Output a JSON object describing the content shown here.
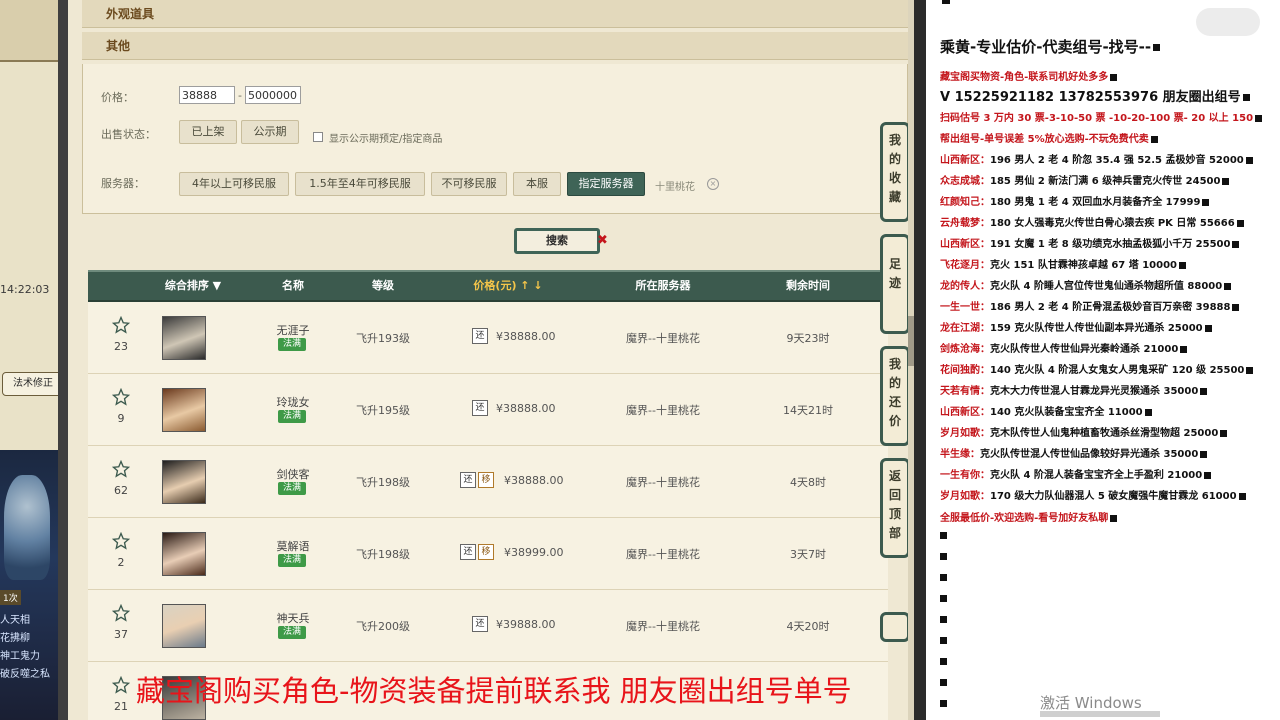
{
  "left_strip": {
    "time": "14:22:03",
    "magic_button": "法术修正",
    "count_badge": "1次",
    "lines": [
      "人天相",
      "花拂柳",
      "神工鬼力",
      "破反噬之私"
    ]
  },
  "sections": {
    "appearance": "外观道具",
    "other": "其他"
  },
  "filter": {
    "price_label": "价格：",
    "price_min": "38888",
    "price_max": "5000000",
    "price_sep": "-",
    "sale_status_label": "出售状态：",
    "status_options": [
      "已上架",
      "公示期"
    ],
    "publicity_checkbox_label": "显示公示期预定/指定商品",
    "server_label": "服务器：",
    "server_options": [
      "4年以上可移民服",
      "1.5年至4年可移民服",
      "不可移民服",
      "本服",
      "指定服务器"
    ],
    "selected_server": "十里桃花",
    "close_glyph": "×"
  },
  "search": {
    "label": "搜索",
    "x_glyph": "✖"
  },
  "table": {
    "headers": {
      "sort": "综合排序 ▼",
      "name": "名称",
      "level": "等级",
      "price": "价格(元) ↑ ↓",
      "server": "所在服务器",
      "remain": "剩余时间"
    },
    "rows": [
      {
        "fav": "23",
        "name": "无涯子",
        "school": "法满",
        "level": "飞升193级",
        "tags": [
          "还"
        ],
        "price": "¥38888.00",
        "server": "魔界--十里桃花",
        "remain": "9天23时"
      },
      {
        "fav": "9",
        "name": "玲珑女",
        "school": "法满",
        "level": "飞升195级",
        "tags": [
          "还"
        ],
        "price": "¥38888.00",
        "server": "魔界--十里桃花",
        "remain": "14天21时"
      },
      {
        "fav": "62",
        "name": "剑侠客",
        "school": "法满",
        "level": "飞升198级",
        "tags": [
          "还",
          "移"
        ],
        "price": "¥38888.00",
        "server": "魔界--十里桃花",
        "remain": "4天8时"
      },
      {
        "fav": "2",
        "name": "莫解语",
        "school": "法满",
        "level": "飞升198级",
        "tags": [
          "还",
          "移"
        ],
        "price": "¥38999.00",
        "server": "魔界--十里桃花",
        "remain": "3天7时"
      },
      {
        "fav": "37",
        "name": "神天兵",
        "school": "法满",
        "level": "飞升200级",
        "tags": [
          "还"
        ],
        "price": "¥39888.00",
        "server": "魔界--十里桃花",
        "remain": "4天20时"
      },
      {
        "fav": "21",
        "name": "",
        "school": "",
        "level": "",
        "tags": [],
        "price": "",
        "server": "",
        "remain": ""
      }
    ]
  },
  "side_nav": {
    "favorites": "我的收藏",
    "footprints": "足迹",
    "my_offers": "我的还价",
    "back_top": "返回顶部"
  },
  "right_panel": {
    "title": "乘黄-专业估价-代卖组号-找号--",
    "line1": "藏宝阁买物资-角色-联系司机好处多多",
    "line2": "V 15225921182   13782553976  朋友圈出组号",
    "line3": "扫码估号 3 万内 30 票-3-10-50 票  -10-20-100 票- 20 以上 150",
    "line4": "帮出组号-单号误差 5%放心选购-不玩免费代卖",
    "entries": [
      {
        "name": "山西新区：",
        "text": "196 男人 2 老 4 阶忽 35.4 强 52.5 孟极妙音 52000"
      },
      {
        "name": "众志成城：",
        "text": "185 男仙 2 新法门满 6 级神兵雷克火传世 24500"
      },
      {
        "name": "红颜知己：",
        "text": "180 男鬼 1 老 4 双回血水月装备齐全 17999"
      },
      {
        "name": "云舟载梦：",
        "text": "180 女人强毒克火传世白骨心猿去疾 PK 日常 55666"
      },
      {
        "name": "山西新区：",
        "text": "191 女魔 1 老 8 级功绩克水抽孟极狐小千万 25500"
      },
      {
        "name": "飞花逐月：",
        "text": "克火 151 队甘霖神孩卓越 67 塔 10000"
      },
      {
        "name": "龙的传人：",
        "text": "克火队 4 阶睡人宫位传世鬼仙通杀物超所值 88000"
      },
      {
        "name": "一生一世：",
        "text": "186 男人 2 老 4 阶正骨混孟极妙音百万亲密 39888"
      },
      {
        "name": "龙在江湖：",
        "text": "159 克火队传世人传世仙副本异光通杀 25000"
      },
      {
        "name": "剑炼沧海：",
        "text": "克火队传世人传世仙异光秦岭通杀 21000"
      },
      {
        "name": "花间独酌：",
        "text": "140 克火队 4 阶混人女鬼女人男鬼采矿 120 级 25500"
      },
      {
        "name": "天若有情：",
        "text": "克木大力传世混人甘霖龙异光灵猴通杀 35000"
      },
      {
        "name": "山西新区：",
        "text": "140 克火队装备宝宝齐全 11000"
      },
      {
        "name": "岁月如歌：",
        "text": "克木队传世人仙鬼种植畜牧通杀丝滑型物超 25000"
      },
      {
        "name": "半生缘：",
        "text": "克火队传世混人传世仙品像较好异光通杀 35000"
      },
      {
        "name": "一生有你：",
        "text": "克火队 4 阶混人装备宝宝齐全上手盈利 21000"
      },
      {
        "name": "岁月如歌：",
        "text": "170 级大力队仙器混人 5 破女魔强牛魔甘霖龙 61000"
      }
    ],
    "footer": "全服最低价-欢迎选购-看号加好友私聊"
  },
  "windows_watermark": "激活 Windows",
  "subtitle": "藏宝阁购买角色-物资装备提前联系我      朋友圈出组号单号"
}
